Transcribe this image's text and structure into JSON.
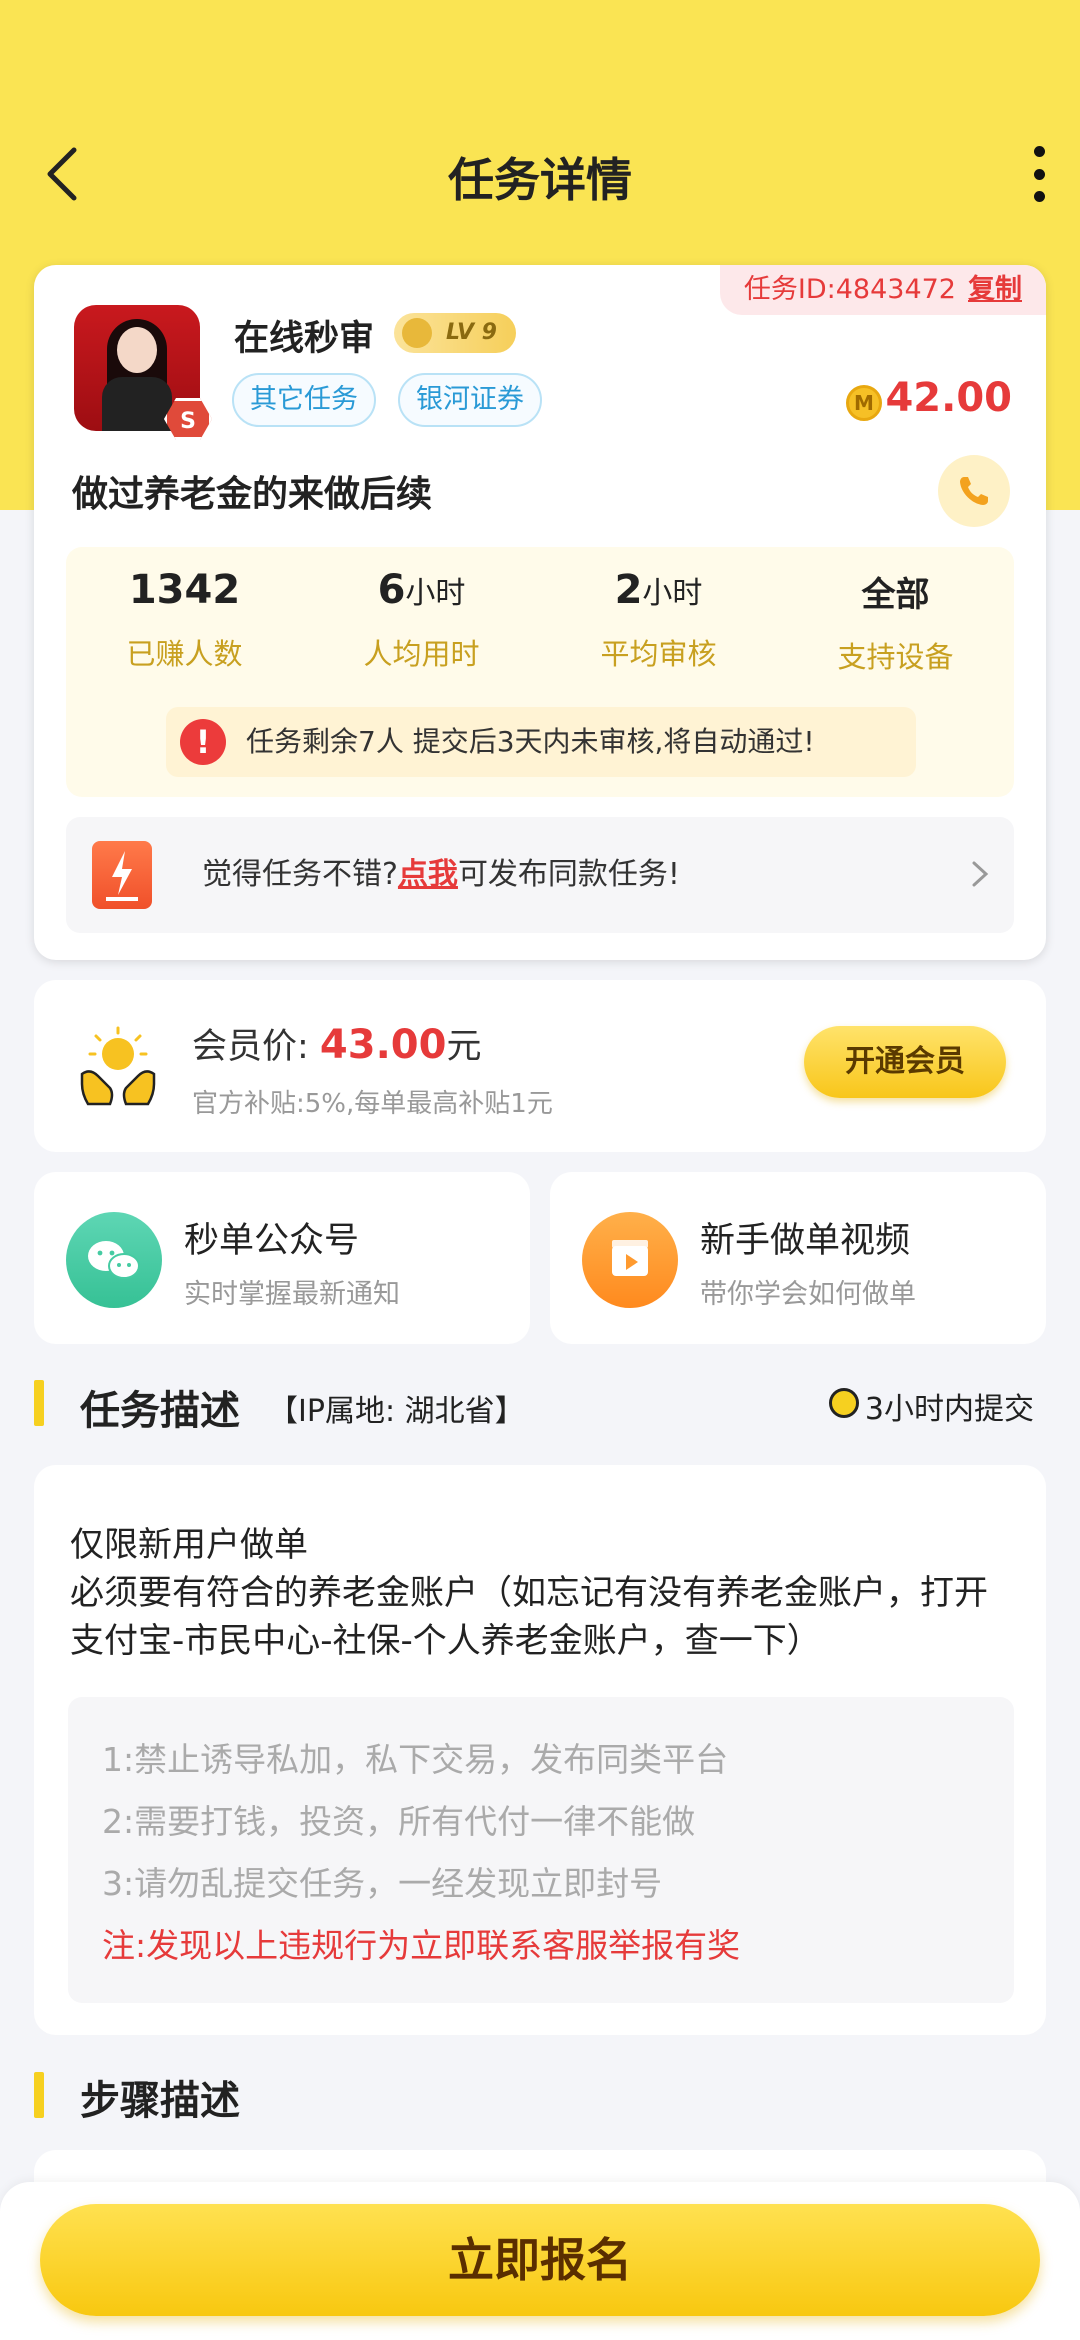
{
  "header": {
    "title": "任务详情"
  },
  "task": {
    "id_text": "任务ID:4843472",
    "copy_label": "复制",
    "user_name": "在线秒审",
    "level": "LV 9",
    "avatar_badge": "S",
    "tags": [
      "其它任务",
      "银河证券"
    ],
    "coin_symbol": "M",
    "price": "42.00",
    "name": "做过养老金的来做后续"
  },
  "stats": [
    {
      "num": "1342",
      "unit": "",
      "label": "已赚人数"
    },
    {
      "num": "6",
      "unit": "小时",
      "label": "人均用时"
    },
    {
      "num": "2",
      "unit": "小时",
      "label": "平均审核"
    },
    {
      "num": "全部",
      "unit": "",
      "label": "支持设备"
    }
  ],
  "notice": {
    "icon": "!",
    "text": "任务剩余7人  提交后3天内未审核,将自动通过!"
  },
  "publish": {
    "pre": "觉得任务不错?",
    "link": "点我",
    "post": "可发布同款任务!"
  },
  "member": {
    "label": "会员价: ",
    "price": "43.00",
    "unit": "元",
    "sub": "官方补贴:5%,每单最高补贴1元",
    "button": "开通会员"
  },
  "quick": [
    {
      "title": "秒单公众号",
      "sub": "实时掌握最新通知"
    },
    {
      "title": "新手做单视频",
      "sub": "带你学会如何做单"
    }
  ],
  "description": {
    "title": "任务描述",
    "ip": "【IP属地: 湖北省】",
    "submit_time": "3小时内提交",
    "lines": [
      "仅限新用户做单",
      "必须要有符合的养老金账户（如忘记有没有养老金账户，打开支付宝-市民中心-社保-个人养老金账户，查一下）"
    ],
    "rules": [
      "1:禁止诱导私加，私下交易，发布同类平台",
      "2:需要打钱，投资，所有代付一律不能做",
      "3:请勿乱提交任务，一经发现立即封号"
    ],
    "warning": "注:发现以上违规行为立即联系客服举报有奖"
  },
  "steps": {
    "title": "步骤描述"
  },
  "bottom": {
    "signup": "立即报名"
  },
  "colors": {
    "brand_yellow": "#fae453",
    "price_red": "#e63a3a",
    "tag_blue": "#2a9ad6",
    "stat_gold": "#c8a020"
  },
  "icons": [
    "back-arrow-icon",
    "more-vertical-icon",
    "phone-icon",
    "coin-icon",
    "warning-icon",
    "lightning-icon",
    "chevron-right-icon",
    "hands-coin-icon",
    "wechat-icon",
    "video-icon",
    "clock-icon"
  ]
}
